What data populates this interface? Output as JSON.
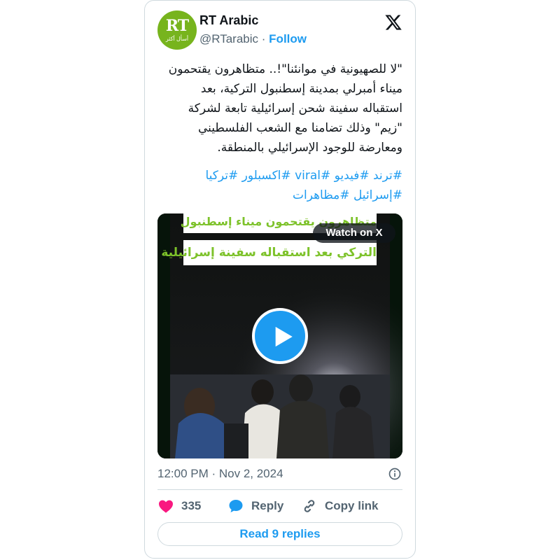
{
  "account": {
    "name": "RT Arabic",
    "handle": "@RTarabic",
    "separator": "·",
    "follow_label": "Follow",
    "avatar_logo": "RT",
    "avatar_subtitle": "أسأل أكثر",
    "avatar_color": "#77b41d"
  },
  "platform_icon": "x-logo-icon",
  "tweet": {
    "text": "\"لا للصهيونية في موانئنا\"!.. متظاهرون يقتحمون ميناء أمبرلي بمدينة إسطنبول التركية، بعد استقباله سفينة شحن إسرائيلية تابعة لشركة \"زيم\" وذلك تضامنا مع الشعب الفلسطيني ومعارضة للوجود الإسرائيلي بالمنطقة.",
    "hashtags": [
      "#ترند",
      "#فيديو",
      "#viral",
      "#اكسبلور",
      "#تركيا",
      "#إسرائيل",
      "#مظاهرات"
    ]
  },
  "media": {
    "caption_line1": "متظاهرون يقتحمون ميناء إسطنبول",
    "caption_line2": "التركي بعد استقباله سفينة إسرائيلية",
    "watch_label": "Watch on X",
    "play_icon": "play-icon",
    "caption_color": "#7dc22a"
  },
  "meta": {
    "timestamp": "12:00 PM · Nov 2, 2024",
    "info_icon": "info-icon"
  },
  "actions": {
    "like_count": "335",
    "reply_label": "Reply",
    "copy_label": "Copy link",
    "like_color": "#f91880",
    "accent_color": "#1d9bf0"
  },
  "footer": {
    "read_replies_label": "Read 9 replies"
  }
}
